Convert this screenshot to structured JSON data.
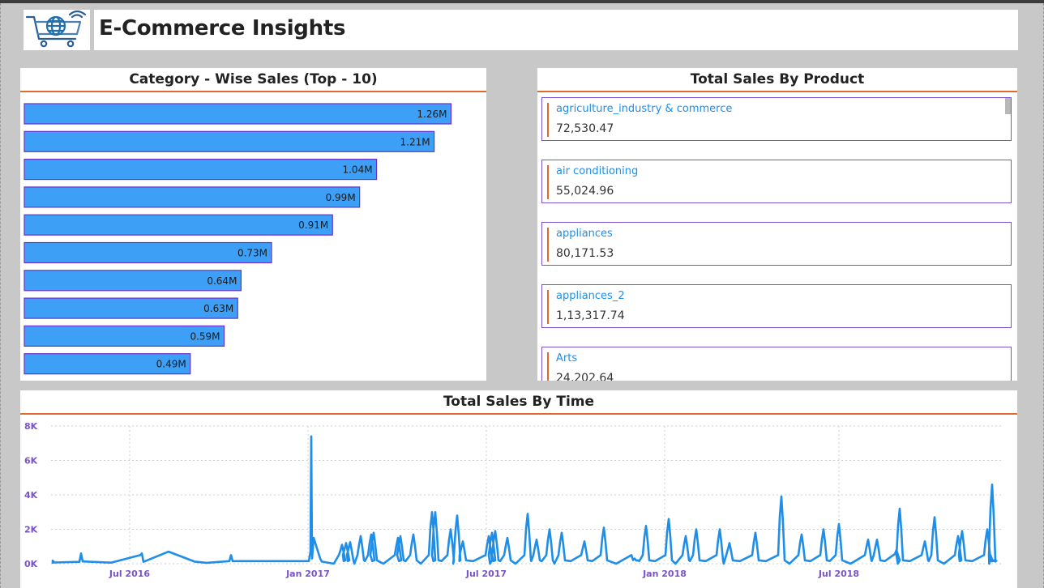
{
  "header": {
    "title": "E-Commerce Insights",
    "logo_icon": "shopping-cart-globe-icon"
  },
  "category_panel": {
    "title": "Category - Wise Sales (Top - 10)"
  },
  "product_panel": {
    "title": "Total Sales By Product",
    "items": [
      {
        "label": "agriculture_industry & commerce",
        "value": "72,530.47"
      },
      {
        "label": "air conditioning",
        "value": "55,024.96"
      },
      {
        "label": "appliances",
        "value": "80,171.53"
      },
      {
        "label": "appliances_2",
        "value": "1,13,317.74"
      },
      {
        "label": "Arts",
        "value": "24,202.64"
      }
    ]
  },
  "time_panel": {
    "title": "Total Sales By Time"
  },
  "colors": {
    "bar_fill": "#3d9ff5",
    "bar_border": "#6a32c8",
    "accent_orange": "#e06a2c",
    "card_border": "#7b53c9",
    "label_blue": "#1f8ee8",
    "axis_purple": "#7b53c9",
    "line_blue": "#1f8ee8"
  },
  "chart_data": [
    {
      "type": "bar",
      "orientation": "horizontal",
      "values": [
        1.26,
        1.21,
        1.04,
        0.99,
        0.91,
        0.73,
        0.64,
        0.63,
        0.59,
        0.49
      ],
      "data_labels": [
        "1.26M",
        "1.21M",
        "1.04M",
        "0.99M",
        "0.91M",
        "0.73M",
        "0.64M",
        "0.63M",
        "0.59M",
        "0.49M"
      ],
      "xlim": [
        0,
        1.4
      ],
      "grid": false
    },
    {
      "type": "line",
      "x_tick_labels": [
        "Jul 2016",
        "Jan 2017",
        "Jul 2017",
        "Jan 2018",
        "Jul 2018"
      ],
      "y_tick_labels": [
        "0K",
        "2K",
        "4K",
        "6K",
        "8K"
      ],
      "ylim": [
        0,
        8000
      ],
      "grid": true
    }
  ]
}
